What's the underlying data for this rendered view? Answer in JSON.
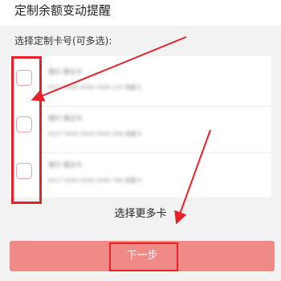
{
  "header": {
    "title": "定制余额变动提醒"
  },
  "section": {
    "label": "选择定制卡号(可多选):"
  },
  "cards": [
    {
      "name": "银行 借记卡",
      "detail": "6217 0000 0000 0000 123 储蓄卡"
    },
    {
      "name": "银行 借记卡",
      "detail": "6217 0000 0000 0000 456 储蓄卡"
    },
    {
      "name": "银行 借记卡",
      "detail": "6217 0000 0000 0000 789 储蓄卡"
    }
  ],
  "more_cards": {
    "label": "选择更多卡"
  },
  "next": {
    "label": "下一步"
  },
  "colors": {
    "primary_button": "#f08a86",
    "annotation": "#e8202a",
    "checkbox_border": "#e7a3a3"
  }
}
